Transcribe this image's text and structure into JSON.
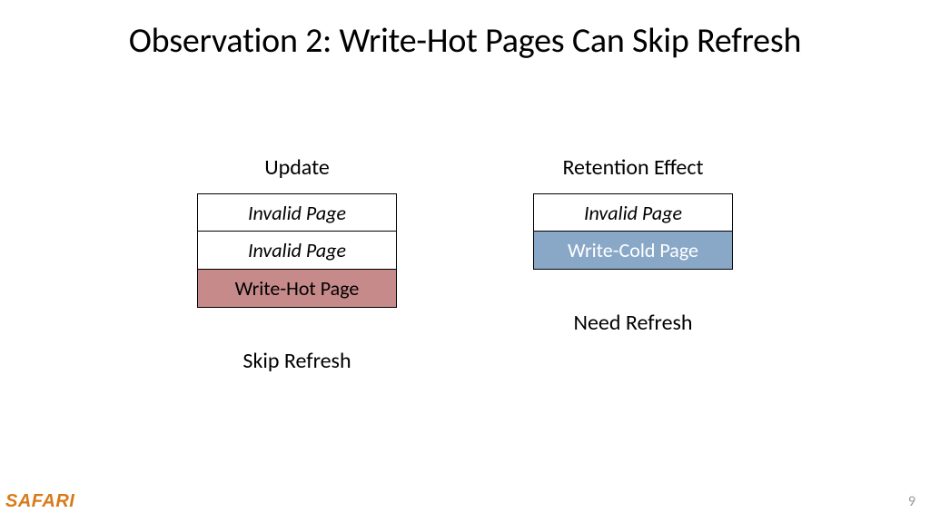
{
  "title": "Observation 2: Write-Hot Pages Can Skip Refresh",
  "columns": {
    "left": {
      "top_label": "Update",
      "cells": {
        "c0": "Invalid Page",
        "c1": "Invalid Page",
        "c2": "Write-Hot Page"
      },
      "bottom_label": "Skip Refresh"
    },
    "right": {
      "top_label": "Retention Effect",
      "cells": {
        "c0": "Invalid Page",
        "c1": "Write-Cold Page"
      },
      "bottom_label": "Need Refresh"
    }
  },
  "logo": "SAFARI",
  "page_number": "9"
}
